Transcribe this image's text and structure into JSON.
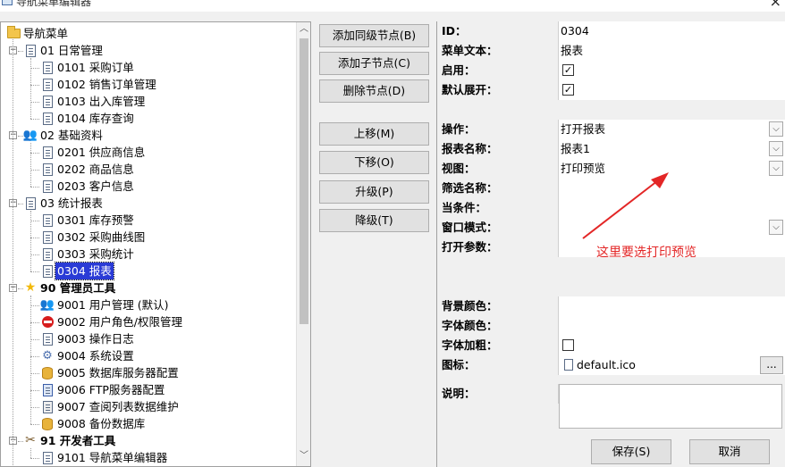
{
  "window": {
    "title": "导航菜单编辑器",
    "close_glyph": "×"
  },
  "tree": {
    "root_label": "导航菜单",
    "items": [
      {
        "label": "01 日常管理",
        "icon": "document-icon",
        "level": 1,
        "expander": "−",
        "bold": false
      },
      {
        "label": "0101 采购订单",
        "icon": "document-icon",
        "level": 2
      },
      {
        "label": "0102 销售订单管理",
        "icon": "document-icon",
        "level": 2
      },
      {
        "label": "0103 出入库管理",
        "icon": "document-icon",
        "level": 2
      },
      {
        "label": "0104 库存查询",
        "icon": "document-icon",
        "level": 2
      },
      {
        "label": "02 基础资料",
        "icon": "users-icon",
        "level": 1,
        "expander": "−",
        "bold": false
      },
      {
        "label": "0201 供应商信息",
        "icon": "document-icon",
        "level": 2
      },
      {
        "label": "0202 商品信息",
        "icon": "document-icon",
        "level": 2
      },
      {
        "label": "0203 客户信息",
        "icon": "document-icon",
        "level": 2
      },
      {
        "label": "03 统计报表",
        "icon": "document-icon",
        "level": 1,
        "expander": "−",
        "bold": false
      },
      {
        "label": "0301 库存预警",
        "icon": "document-icon",
        "level": 2
      },
      {
        "label": "0302 采购曲线图",
        "icon": "document-icon",
        "level": 2
      },
      {
        "label": "0303 采购统计",
        "icon": "document-icon",
        "level": 2
      },
      {
        "label": "0304 报表",
        "icon": "document-icon",
        "level": 2,
        "selected": true
      },
      {
        "label": "90 管理员工具",
        "icon": "star-icon",
        "level": 1,
        "expander": "−",
        "bold": true
      },
      {
        "label": "9001 用户管理 (默认)",
        "icon": "users-icon",
        "level": 2
      },
      {
        "label": "9002 用户角色/权限管理",
        "icon": "stop-icon",
        "level": 2
      },
      {
        "label": "9003 操作日志",
        "icon": "document-icon",
        "level": 2
      },
      {
        "label": "9004 系统设置",
        "icon": "gear-icon",
        "level": 2
      },
      {
        "label": "9005 数据库服务器配置",
        "icon": "database-icon",
        "level": 2
      },
      {
        "label": "9006 FTP服务器配置",
        "icon": "server-icon",
        "level": 2
      },
      {
        "label": "9007 查阅列表数据维护",
        "icon": "list-icon",
        "level": 2
      },
      {
        "label": "9008 备份数据库",
        "icon": "database-icon",
        "level": 2
      },
      {
        "label": "91 开发者工具",
        "icon": "tools-icon",
        "level": 1,
        "expander": "−",
        "bold": true
      },
      {
        "label": "9101 导航菜单编辑器",
        "icon": "document-icon",
        "level": 2
      }
    ]
  },
  "actions": {
    "add_sibling": "添加同级节点(B)",
    "add_child": "添加子节点(C)",
    "delete_node": "删除节点(D)",
    "move_up": "上移(M)",
    "move_down": "下移(O)",
    "promote": "升级(P)",
    "demote": "降级(T)"
  },
  "properties": {
    "id": {
      "label": "ID：",
      "value": "0304"
    },
    "menu_text": {
      "label": "菜单文本：",
      "value": "报表"
    },
    "enabled": {
      "label": "启用：",
      "checked": true
    },
    "default_expand": {
      "label": "默认展开：",
      "checked": true
    },
    "operation": {
      "label": "操作：",
      "value": "打开报表"
    },
    "report_name": {
      "label": "报表名称：",
      "value": "报表1"
    },
    "view": {
      "label": "视图：",
      "value": "打印预览"
    },
    "filter_name": {
      "label": "筛选名称：",
      "value": ""
    },
    "condition": {
      "label": "当条件：",
      "value": ""
    },
    "window_mode": {
      "label": "窗口模式：",
      "value": ""
    },
    "open_params": {
      "label": "打开参数：",
      "value": ""
    },
    "bg_color": {
      "label": "背景颜色：",
      "value": ""
    },
    "font_color": {
      "label": "字体颜色：",
      "value": ""
    },
    "font_bold": {
      "label": "字体加粗：",
      "checked": false
    },
    "icon": {
      "label": "图标：",
      "value": "default.ico",
      "browse": "..."
    },
    "description": {
      "label": "说明："
    }
  },
  "footer": {
    "save": "保存(S)",
    "cancel": "取消"
  },
  "annotation": {
    "text": "这里要选打印预览",
    "color": "#e32626"
  },
  "glyphs": {
    "combo_arrow": "⌵",
    "check": "✓",
    "scroll_up": "︿",
    "scroll_down": "﹀"
  }
}
